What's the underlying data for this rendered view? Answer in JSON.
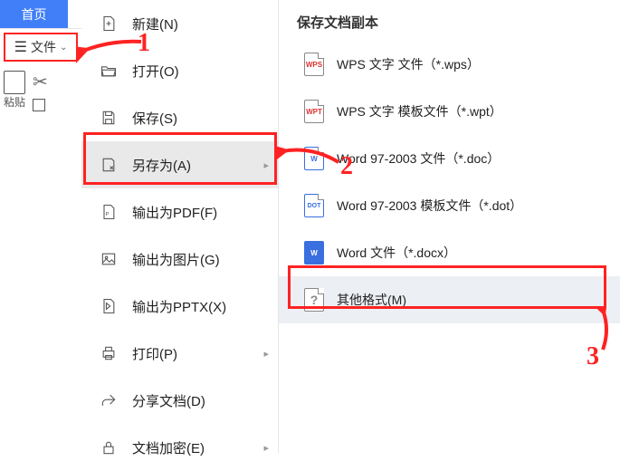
{
  "topbar": {
    "home_tab": "首页"
  },
  "left": {
    "file_button": "文件",
    "paste_label": "粘贴"
  },
  "menu": {
    "items": [
      {
        "label": "新建(N)",
        "icon": "new"
      },
      {
        "label": "打开(O)",
        "icon": "open"
      },
      {
        "label": "保存(S)",
        "icon": "save"
      },
      {
        "label": "另存为(A)",
        "icon": "saveas",
        "highlight": true,
        "submenu": true
      },
      {
        "label": "输出为PDF(F)",
        "icon": "pdf"
      },
      {
        "label": "输出为图片(G)",
        "icon": "image"
      },
      {
        "label": "输出为PPTX(X)",
        "icon": "pptx"
      },
      {
        "label": "打印(P)",
        "icon": "print",
        "submenu": true
      },
      {
        "label": "分享文档(D)",
        "icon": "share"
      },
      {
        "label": "文档加密(E)",
        "icon": "encrypt",
        "submenu": true
      }
    ]
  },
  "panel": {
    "title": "保存文档副本",
    "types": [
      {
        "label": "WPS 文字 文件（*.wps）",
        "badge": "WPS",
        "style": "red"
      },
      {
        "label": "WPS 文字 模板文件（*.wpt）",
        "badge": "WPT",
        "style": "red"
      },
      {
        "label": "Word 97-2003 文件（*.doc）",
        "badge": "W",
        "style": "outlined"
      },
      {
        "label": "Word 97-2003 模板文件（*.dot）",
        "badge": "DOT",
        "style": "outlined"
      },
      {
        "label": "Word 文件（*.docx）",
        "badge": "W",
        "style": "blue"
      },
      {
        "label": "其他格式(M)",
        "badge": "?",
        "style": "q",
        "highlight": true
      }
    ]
  },
  "annotations": {
    "n1": "1",
    "n2": "2",
    "n3": "3"
  }
}
